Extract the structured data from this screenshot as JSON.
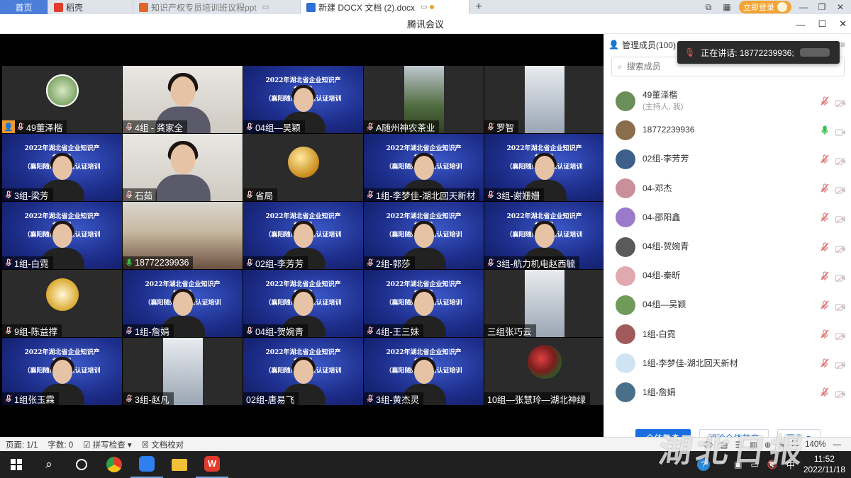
{
  "tabs": [
    {
      "label": "首页"
    },
    {
      "label": "稻壳"
    },
    {
      "label": "知识产权专员培训班议程ppt"
    },
    {
      "label": "新建 DOCX 文档 (2).docx"
    }
  ],
  "header": {
    "login_label": "立即登录"
  },
  "meeting": {
    "title": "腾讯会议"
  },
  "banner_text": [
    "2022年湖北省企业知识产权专员",
    "（襄阳随州）考核认证培训班"
  ],
  "tiles": [
    {
      "name": "49董泽楷",
      "bg": "plain",
      "art": "portrait",
      "host": true,
      "mic": "muted"
    },
    {
      "name": "4组 - 龚家全",
      "bg": "light",
      "art": "person",
      "mic": "muted"
    },
    {
      "name": "04组—吴颖",
      "bg": "blue",
      "art": "banner",
      "mic": "muted"
    },
    {
      "name": "A随州神农茶业",
      "bg": "plain",
      "art": "tree",
      "mic": "muted"
    },
    {
      "name": "罗智",
      "bg": "plain",
      "art": "tall",
      "mic": "muted"
    },
    {
      "name": "3组-梁芳",
      "bg": "blue",
      "art": "banner",
      "mic": "muted"
    },
    {
      "name": "石茹",
      "bg": "light",
      "art": "person",
      "mic": "muted"
    },
    {
      "name": "省局",
      "bg": "plain",
      "art": "circle",
      "mic": "muted"
    },
    {
      "name": "1组-李梦佳-湖北回天新材",
      "bg": "blue",
      "art": "banner",
      "mic": "muted"
    },
    {
      "name": "3组-谢姗姗",
      "bg": "blue",
      "art": "banner",
      "mic": "muted"
    },
    {
      "name": "1组-白霓",
      "bg": "blue",
      "art": "banner",
      "mic": "muted"
    },
    {
      "name": "18772239936",
      "bg": "room",
      "art": "none",
      "mic": "active"
    },
    {
      "name": "02组-李芳芳",
      "bg": "blue",
      "art": "banner",
      "mic": "muted"
    },
    {
      "name": "2组-郭莎",
      "bg": "blue",
      "art": "banner",
      "mic": "muted"
    },
    {
      "name": "3组-航力机电赵西毓",
      "bg": "blue",
      "art": "banner",
      "mic": "muted"
    },
    {
      "name": "9组-陈益撑",
      "bg": "plain",
      "art": "cert",
      "mic": "muted"
    },
    {
      "name": "1组-詹娟",
      "bg": "blue",
      "art": "banner",
      "mic": "muted"
    },
    {
      "name": "04组-贺婉青",
      "bg": "blue",
      "art": "banner",
      "mic": "muted"
    },
    {
      "name": "4组-王三妹",
      "bg": "blue",
      "art": "banner",
      "mic": "muted"
    },
    {
      "name": "三组张巧云",
      "bg": "plain",
      "art": "tall",
      "mic": "none"
    },
    {
      "name": "1组张玉霖",
      "bg": "blue",
      "art": "banner",
      "mic": "muted"
    },
    {
      "name": "3组-赵凡",
      "bg": "plain",
      "art": "tall",
      "mic": "muted"
    },
    {
      "name": "02组-唐易飞",
      "bg": "blue",
      "art": "banner",
      "mic": "none"
    },
    {
      "name": "3组-黄杰灵",
      "bg": "blue",
      "art": "banner",
      "mic": "muted"
    },
    {
      "name": "10组—张慧玲—湖北神绿",
      "bg": "plain",
      "art": "flowers",
      "mic": "none"
    }
  ],
  "panel": {
    "title": "管理成员(100)",
    "search_placeholder": "搜索成员",
    "buttons": {
      "mute_all": "全体静音",
      "unmute_all": "解除全体静音",
      "more": "更多"
    }
  },
  "members": [
    {
      "name": "49董泽楷",
      "sub": "(主持人, 我)",
      "color": "#6b8f5a",
      "mic": "muted"
    },
    {
      "name": "18772239936",
      "sub": "",
      "color": "#8a6d4a",
      "mic": "active"
    },
    {
      "name": "02组-李芳芳",
      "sub": "",
      "color": "#3d5f8a",
      "mic": "muted"
    },
    {
      "name": "04-邓杰",
      "sub": "",
      "color": "#c98f9a",
      "mic": "muted"
    },
    {
      "name": "04-邵阳鑫",
      "sub": "",
      "color": "#9a7ac9",
      "mic": "muted"
    },
    {
      "name": "04组-贺婉青",
      "sub": "",
      "color": "#5a5a5a",
      "mic": "muted"
    },
    {
      "name": "04组-秦昕",
      "sub": "",
      "color": "#e0a9b0",
      "mic": "muted"
    },
    {
      "name": "04组—吴颖",
      "sub": "",
      "color": "#6f9a5a",
      "mic": "muted"
    },
    {
      "name": "1组-白霓",
      "sub": "",
      "color": "#a05a5a",
      "mic": "muted"
    },
    {
      "name": "1组-李梦佳-湖北回天新材",
      "sub": "",
      "color": "#cfe4f2",
      "mic": "muted"
    },
    {
      "name": "1组-詹娟",
      "sub": "",
      "color": "#4a6f8a",
      "mic": "muted"
    }
  ],
  "toast": {
    "text": "正在讲话: 18772239936;"
  },
  "statusbar": {
    "page": "页面: 1/1",
    "words": "字数: 0",
    "spellcheck": "拼写检查",
    "proofread": "文档校对",
    "zoom": "140%"
  },
  "taskbar": {
    "ime": "中",
    "time": "11:52",
    "date": "2022/11/18"
  },
  "colors": {
    "accent": "#1a6fe0",
    "muted_mic": "#e85c5c",
    "active_mic": "#35c24b"
  }
}
